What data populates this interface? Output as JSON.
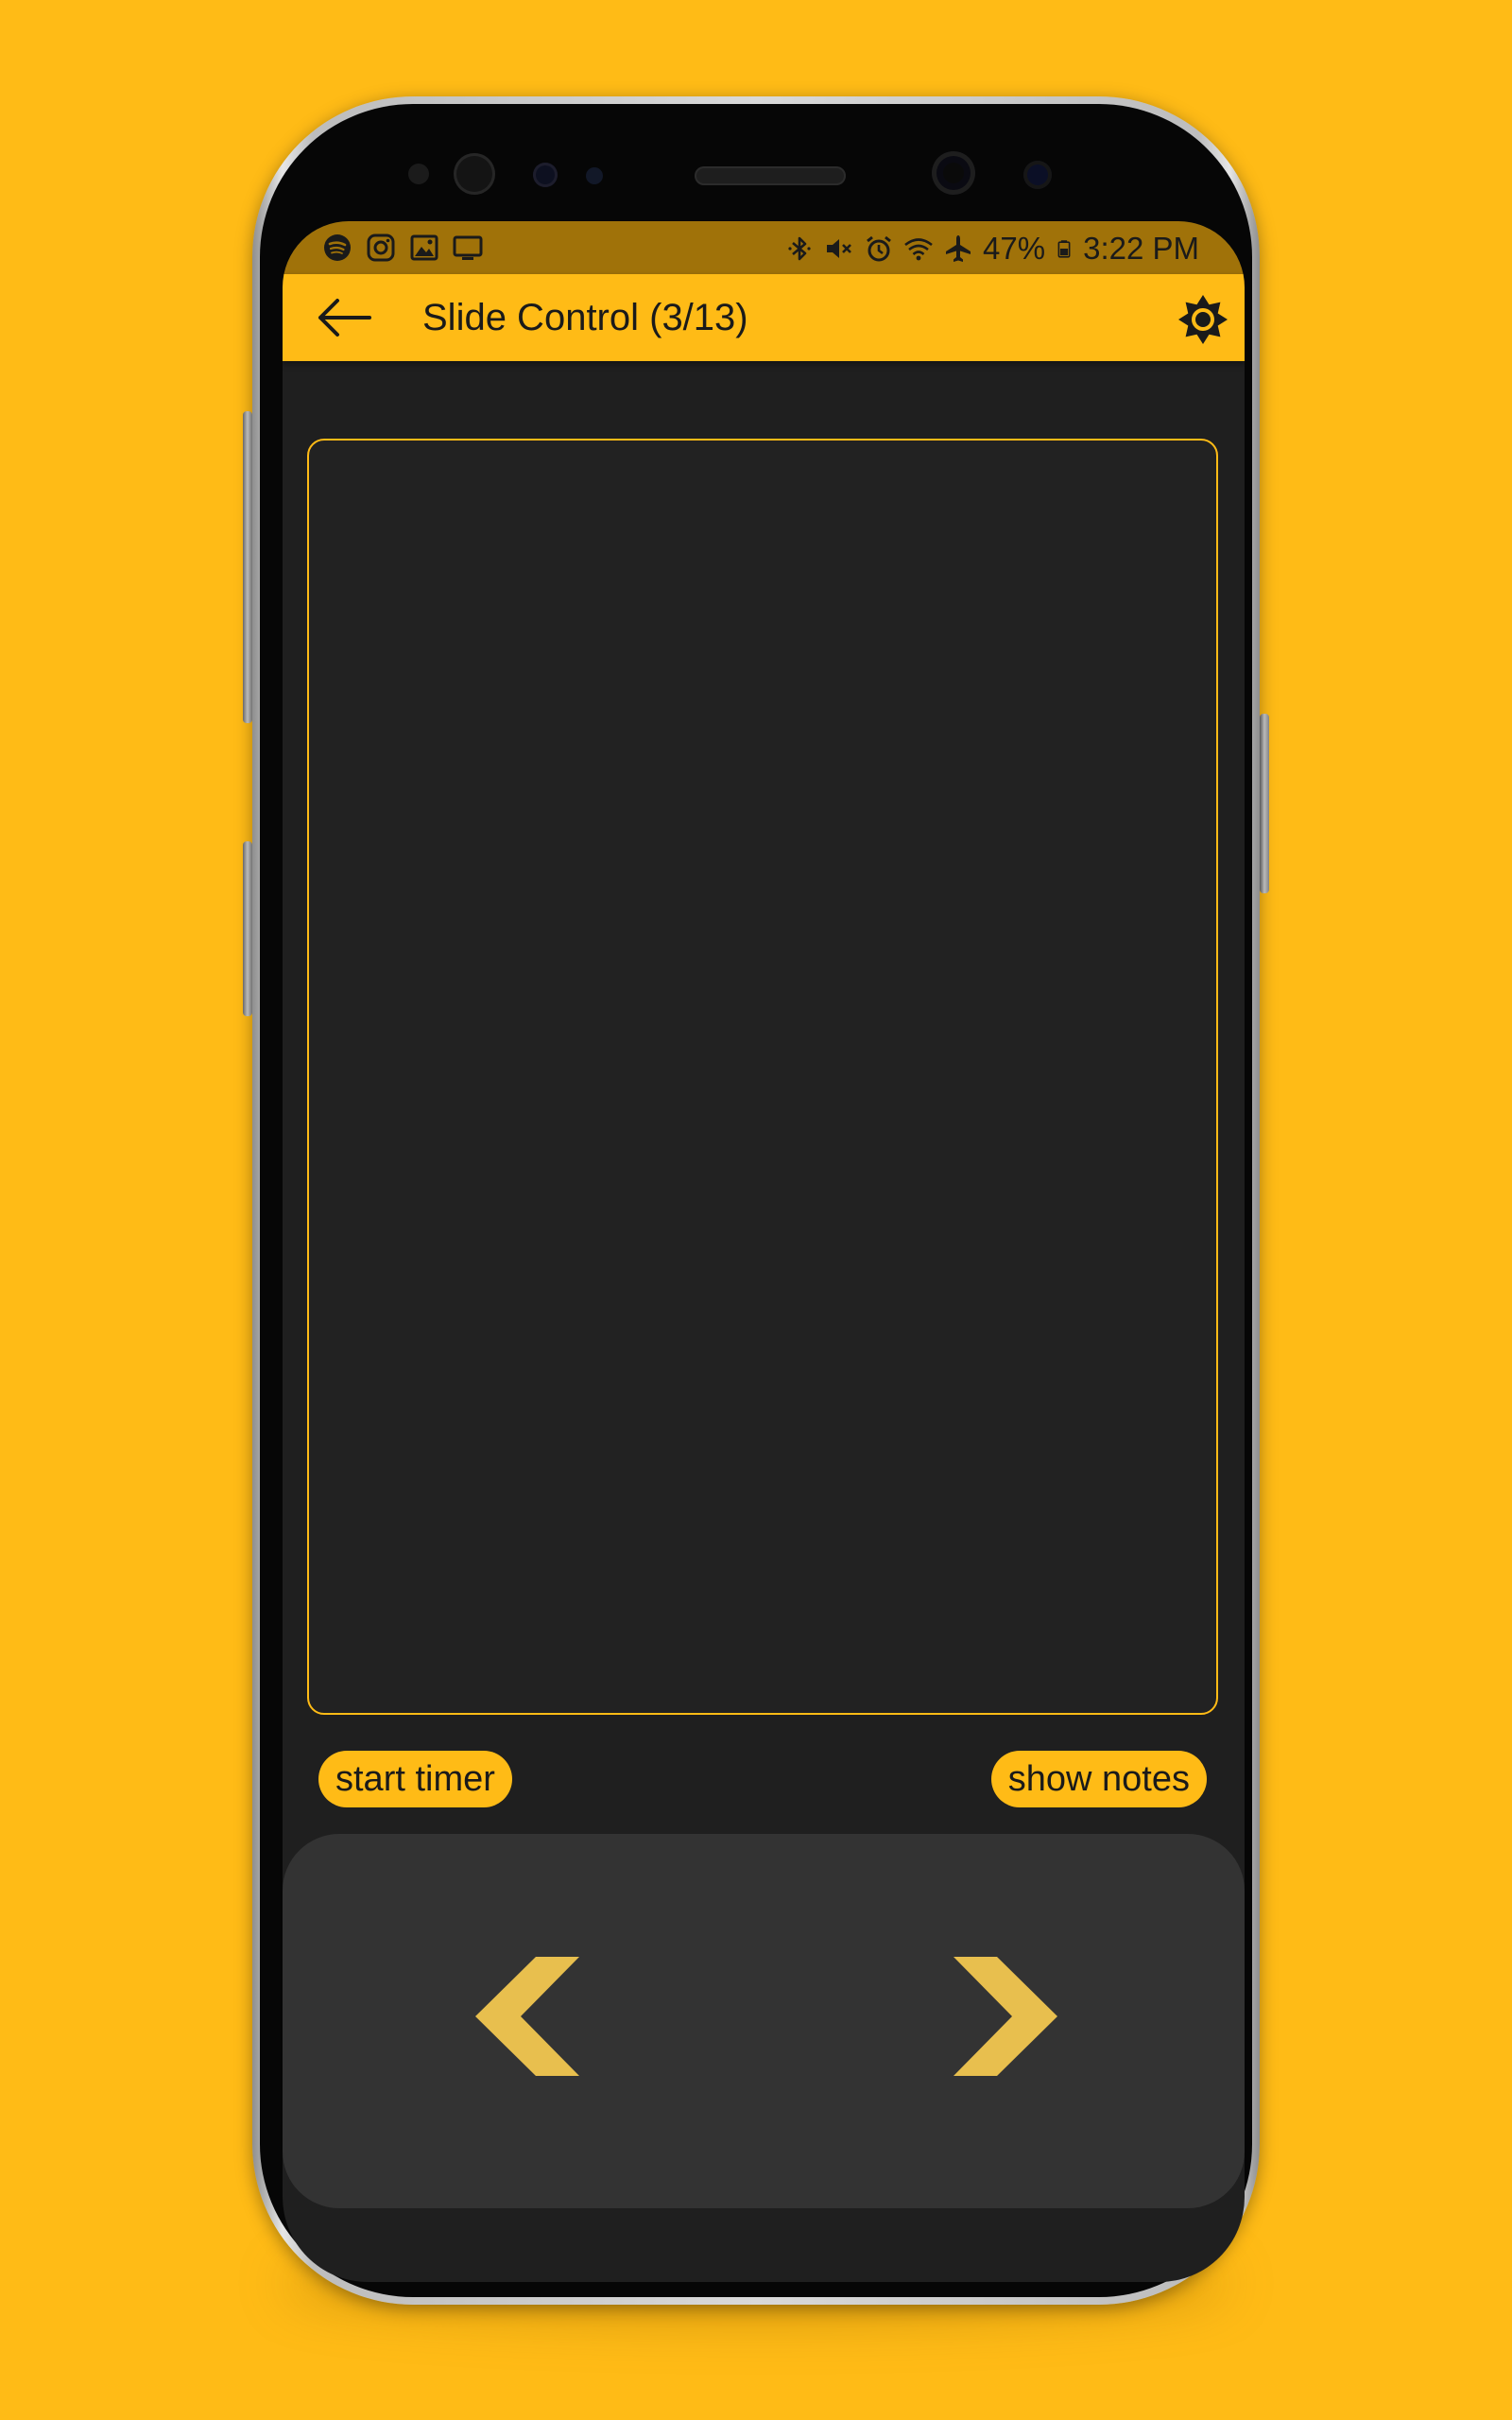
{
  "status_bar": {
    "left_icons": [
      "spotify-icon",
      "instagram-icon",
      "gallery-icon",
      "cast-icon"
    ],
    "right_icons": [
      "bluetooth-icon",
      "mute-icon",
      "alarm-icon",
      "wifi-icon",
      "airplane-icon",
      "battery-icon"
    ],
    "battery": "47%",
    "time": "3:22 PM"
  },
  "app_bar": {
    "title": "Slide Control (3/13)",
    "back_icon": "arrow-left-icon",
    "settings_icon": "brightness-icon"
  },
  "controls": {
    "start_timer_label": "start timer",
    "show_notes_label": "show notes",
    "prev_icon": "chevron-left-icon",
    "next_icon": "chevron-right-icon"
  },
  "colors": {
    "accent": "#FFBB16",
    "status_bar": "#A07209",
    "screen_bg": "#1f1f1f",
    "panel_bg": "#333333",
    "chevron": "#E8BF4E"
  }
}
